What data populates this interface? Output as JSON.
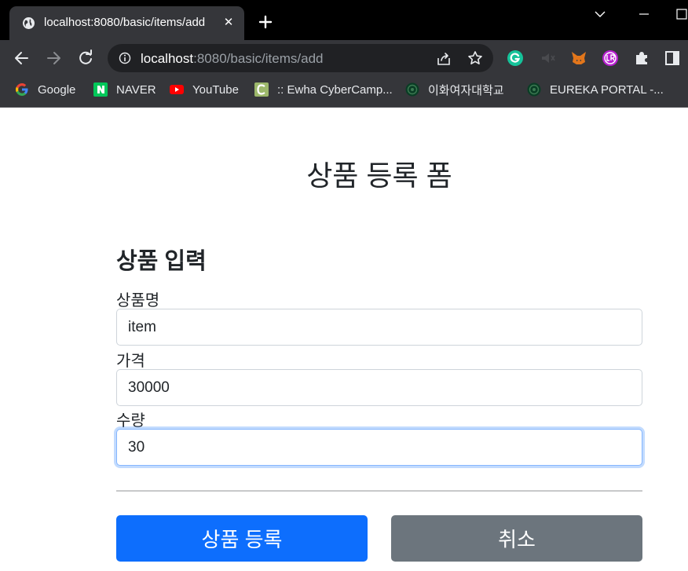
{
  "browser": {
    "tab_title": "localhost:8080/basic/items/add",
    "url_host": "localhost",
    "url_path": ":8080/basic/items/add",
    "bookmarks": [
      {
        "label": "Google",
        "icon": "google-icon"
      },
      {
        "label": "NAVER",
        "icon": "naver-icon"
      },
      {
        "label": "YouTube",
        "icon": "youtube-icon"
      },
      {
        "label": ":: Ewha CyberCamp...",
        "icon": "cybercampus-icon"
      },
      {
        "label": "이화여자대학교",
        "icon": "ewha-icon"
      },
      {
        "label": "EUREKA PORTAL -...",
        "icon": "eureka-icon"
      }
    ],
    "extensions": [
      "grammarly-icon",
      "audio-icon",
      "metamask-icon",
      "language-reactor-icon",
      "puzzle-icon",
      "sidepanel-icon"
    ]
  },
  "page": {
    "title": "상품 등록 폼",
    "section_title": "상품 입력",
    "fields": [
      {
        "label": "상품명",
        "value": "item"
      },
      {
        "label": "가격",
        "value": "30000"
      },
      {
        "label": "수량",
        "value": "30"
      }
    ],
    "submit_label": "상품 등록",
    "cancel_label": "취소"
  },
  "colors": {
    "primary": "#0d6efd",
    "secondary": "#6c757d",
    "focus_border": "#86b7fe",
    "chrome_dark": "#35363a"
  }
}
